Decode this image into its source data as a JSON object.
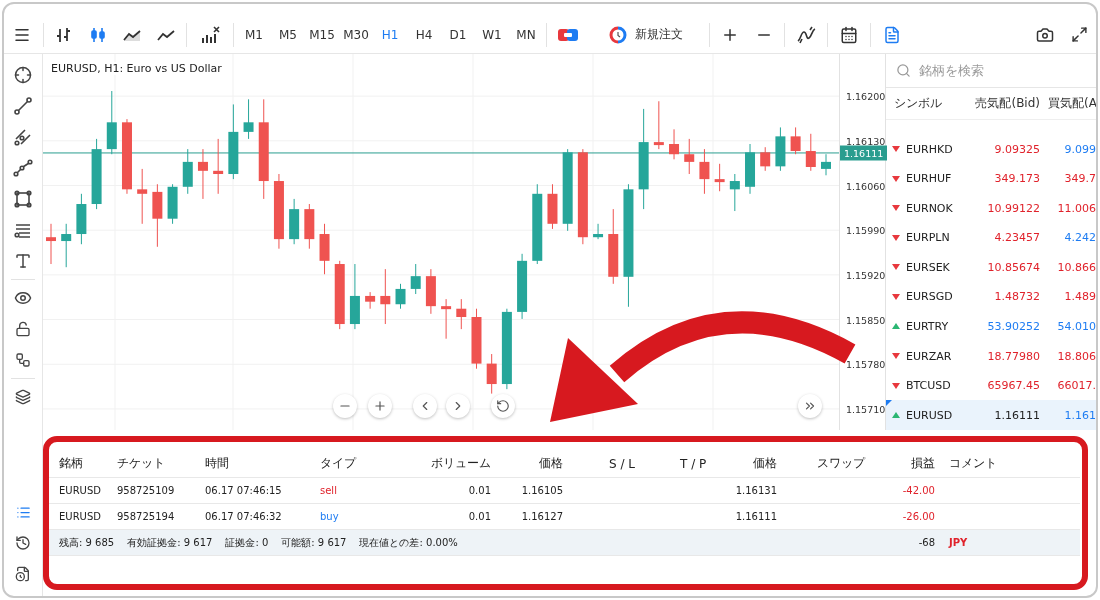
{
  "toolbar": {
    "chart_types": [
      {
        "selected": false
      },
      {
        "selected": true
      },
      {
        "selected": false
      },
      {
        "selected": false
      }
    ],
    "timeframes": [
      {
        "label": "M1",
        "selected": false
      },
      {
        "label": "M5",
        "selected": false
      },
      {
        "label": "M15",
        "selected": false
      },
      {
        "label": "M30",
        "selected": false
      },
      {
        "label": "H1",
        "selected": true
      },
      {
        "label": "H4",
        "selected": false
      },
      {
        "label": "D1",
        "selected": false
      },
      {
        "label": "W1",
        "selected": false
      },
      {
        "label": "MN",
        "selected": false
      }
    ],
    "order_button": {
      "label": "新規注文"
    },
    "notes_active": true
  },
  "left_tools": {
    "bottom": [
      {
        "selected": true
      },
      {
        "selected": false
      },
      {
        "selected": false
      }
    ]
  },
  "chart": {
    "title": "EURUSD, H1: Euro vs US Dollar",
    "chart_data": {
      "type": "candlestick",
      "ylim": [
        1.15677,
        1.16266
      ],
      "grid": true,
      "ref_lines": [
        {
          "axis": "y",
          "value": 1.16111,
          "label": "1.16111",
          "color": "#2a9d8f"
        }
      ],
      "yticks": [
        {
          "value": 1.162,
          "label": "1.16200"
        },
        {
          "value": 1.1613,
          "label": "1.16130"
        },
        {
          "value": 1.1606,
          "label": "1.16060"
        },
        {
          "value": 1.1599,
          "label": "1.15990"
        },
        {
          "value": 1.1592,
          "label": "1.15920"
        },
        {
          "value": 1.1585,
          "label": "1.15850"
        },
        {
          "value": 1.1578,
          "label": "1.15780"
        },
        {
          "value": 1.1571,
          "label": "1.15710"
        }
      ],
      "ohlc": [
        [
          1.15979,
          1.16,
          1.15937,
          1.15973
        ],
        [
          1.15973,
          1.16,
          1.15932,
          1.15984
        ],
        [
          1.15984,
          1.16047,
          1.15968,
          1.16031
        ],
        [
          1.16031,
          1.16133,
          1.16023,
          1.16117
        ],
        [
          1.16117,
          1.16208,
          1.16109,
          1.16159
        ],
        [
          1.16159,
          1.16164,
          1.16047,
          1.16054
        ],
        [
          1.16054,
          1.16086,
          1.16,
          1.16047
        ],
        [
          1.1605,
          1.16062,
          1.15964,
          1.16008
        ],
        [
          1.16008,
          1.16062,
          1.16,
          1.16058
        ],
        [
          1.16058,
          1.16117,
          1.16047,
          1.16097
        ],
        [
          1.16097,
          1.16117,
          1.16039,
          1.16083
        ],
        [
          1.16083,
          1.16133,
          1.16047,
          1.16078
        ],
        [
          1.16078,
          1.16187,
          1.1607,
          1.16144
        ],
        [
          1.16144,
          1.16195,
          1.16133,
          1.16159
        ],
        [
          1.16159,
          1.16195,
          1.16039,
          1.16067
        ],
        [
          1.16067,
          1.16078,
          1.15961,
          1.15976
        ],
        [
          1.15976,
          1.16039,
          1.15968,
          1.16023
        ],
        [
          1.16023,
          1.16031,
          1.15961,
          1.15976
        ],
        [
          1.15984,
          1.16,
          1.15921,
          1.15942
        ],
        [
          1.15937,
          1.15942,
          1.15835,
          1.15843
        ],
        [
          1.15843,
          1.15937,
          1.15835,
          1.15887
        ],
        [
          1.15887,
          1.15893,
          1.15867,
          1.15878
        ],
        [
          1.15887,
          1.15929,
          1.15843,
          1.15874
        ],
        [
          1.15874,
          1.15906,
          1.15867,
          1.15898
        ],
        [
          1.15898,
          1.15937,
          1.1589,
          1.15918
        ],
        [
          1.15918,
          1.15929,
          1.15859,
          1.15871
        ],
        [
          1.15871,
          1.15882,
          1.1582,
          1.15867
        ],
        [
          1.15867,
          1.15882,
          1.15835,
          1.15854
        ],
        [
          1.15854,
          1.15867,
          1.15773,
          1.15781
        ],
        [
          1.15781,
          1.15796,
          1.15734,
          1.15749
        ],
        [
          1.15749,
          1.15867,
          1.15741,
          1.15862
        ],
        [
          1.15862,
          1.15953,
          1.15851,
          1.15942
        ],
        [
          1.15942,
          1.16062,
          1.15937,
          1.16047
        ],
        [
          1.16047,
          1.16062,
          1.15992,
          1.16
        ],
        [
          1.16,
          1.16117,
          1.15989,
          1.16112
        ],
        [
          1.16112,
          1.16117,
          1.15968,
          1.15979
        ],
        [
          1.15979,
          1.16,
          1.15976,
          1.15984
        ],
        [
          1.15984,
          1.16023,
          1.15906,
          1.15917
        ],
        [
          1.15917,
          1.16062,
          1.1587,
          1.16054
        ],
        [
          1.16054,
          1.1618,
          1.16023,
          1.16128
        ],
        [
          1.16128,
          1.16192,
          1.16117,
          1.16125
        ],
        [
          1.16125,
          1.16148,
          1.16101,
          1.16109
        ],
        [
          1.16109,
          1.16133,
          1.16078,
          1.16097
        ],
        [
          1.16097,
          1.16117,
          1.16047,
          1.1607
        ],
        [
          1.1607,
          1.16094,
          1.16051,
          1.16067
        ],
        [
          1.16054,
          1.16078,
          1.1602,
          1.16067
        ],
        [
          1.16058,
          1.16125,
          1.16047,
          1.16112
        ],
        [
          1.16112,
          1.1612,
          1.16083,
          1.1609
        ],
        [
          1.1609,
          1.16151,
          1.16083,
          1.16137
        ],
        [
          1.16137,
          1.16151,
          1.16109,
          1.16114
        ],
        [
          1.16114,
          1.16141,
          1.16083,
          1.16089
        ],
        [
          1.16086,
          1.16109,
          1.16076,
          1.16097
        ]
      ]
    }
  },
  "watchlist": {
    "search": {
      "placeholder": "銘柄を検索"
    },
    "columns": [
      "シンボル",
      "売気配(Bid)",
      "買気配(A"
    ],
    "rows": [
      {
        "symbol": "EURHKD",
        "rising": false,
        "bid": {
          "text": "9.09325",
          "kind": "down"
        },
        "ask": "9.099",
        "ask_up": true,
        "selected": false
      },
      {
        "symbol": "EURHUF",
        "rising": false,
        "bid": {
          "text": "349.173",
          "kind": "down"
        },
        "ask": "349.7",
        "ask_up": false,
        "selected": false
      },
      {
        "symbol": "EURNOK",
        "rising": false,
        "bid": {
          "text": "10.99122",
          "kind": "down"
        },
        "ask": "11.006",
        "ask_up": false,
        "selected": false
      },
      {
        "symbol": "EURPLN",
        "rising": false,
        "bid": {
          "text": "4.23457",
          "kind": "down"
        },
        "ask": "4.242",
        "ask_up": true,
        "selected": false
      },
      {
        "symbol": "EURSEK",
        "rising": false,
        "bid": {
          "text": "10.85674",
          "kind": "down"
        },
        "ask": "10.866",
        "ask_up": false,
        "selected": false
      },
      {
        "symbol": "EURSGD",
        "rising": false,
        "bid": {
          "text": "1.48732",
          "kind": "down"
        },
        "ask": "1.489",
        "ask_up": false,
        "selected": false
      },
      {
        "symbol": "EURTRY",
        "rising": true,
        "bid": {
          "text": "53.90252",
          "kind": "up"
        },
        "ask": "54.010",
        "ask_up": true,
        "selected": false
      },
      {
        "symbol": "EURZAR",
        "rising": false,
        "bid": {
          "text": "18.77980",
          "kind": "down"
        },
        "ask": "18.806",
        "ask_up": false,
        "selected": false
      },
      {
        "symbol": "BTCUSD",
        "rising": false,
        "bid": {
          "text": "65967.45",
          "kind": "down"
        },
        "ask": "66017.",
        "ask_up": false,
        "selected": false
      },
      {
        "symbol": "EURUSD",
        "rising": true,
        "bid": {
          "text": "1.16111",
          "kind": "flat"
        },
        "ask": "1.161",
        "ask_up": true,
        "selected": true
      }
    ]
  },
  "positions": {
    "columns": [
      "銘柄",
      "チケット",
      "時間",
      "タイプ",
      "ボリューム",
      "価格",
      "S / L",
      "T / P",
      "価格",
      "スワップ",
      "損益",
      "コメント"
    ],
    "rows": [
      {
        "symbol": "EURUSD",
        "ticket": "958725109",
        "time": "06.17 07:46:15",
        "type": "sell",
        "buy": false,
        "volume": "0.01",
        "open_price": "1.16105",
        "current_price": "1.16131",
        "profit": "-42.00",
        "loss": true
      },
      {
        "symbol": "EURUSD",
        "ticket": "958725194",
        "time": "06.17 07:46:32",
        "type": "buy",
        "buy": true,
        "volume": "0.01",
        "open_price": "1.16127",
        "current_price": "1.16111",
        "profit": "-26.00",
        "loss": true
      }
    ],
    "summary": {
      "items": [
        "残高: 9 685",
        "有効証拠金: 9 617",
        "証拠金: 0",
        "可能額: 9 617",
        "現在値との差: 0.00%"
      ],
      "total": "-68",
      "currency": "JPY"
    }
  }
}
